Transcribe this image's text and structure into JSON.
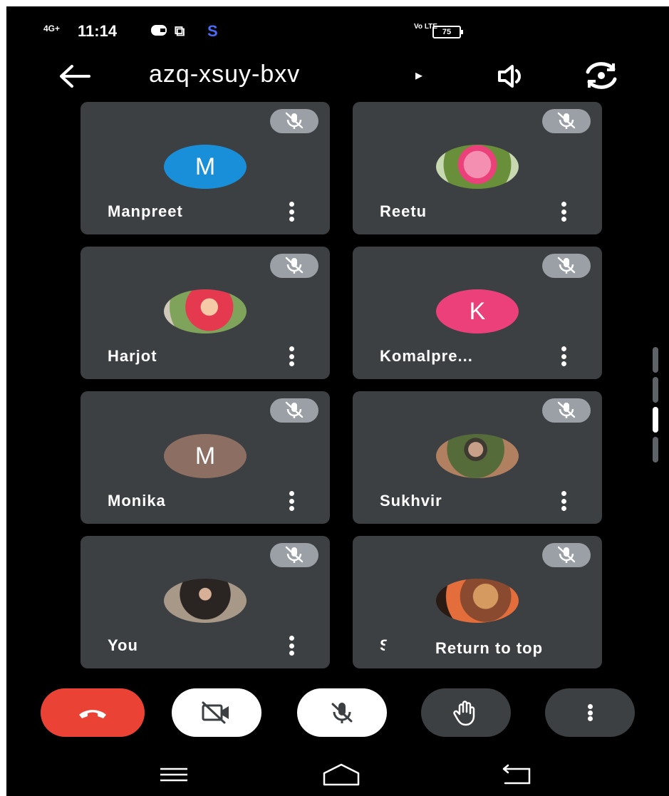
{
  "status_bar": {
    "signal": "4G+",
    "time": "11:14",
    "app_badge": "S",
    "volte": "Vo LTE",
    "battery": "75"
  },
  "header": {
    "meeting_code": "azq-xsuy-bxv",
    "caret": "▸"
  },
  "participants": [
    {
      "name": "Manpreet",
      "avatar_letter": "M",
      "avatar_color": "#1a8fd9",
      "avatar_kind": "letter"
    },
    {
      "name": "Reetu",
      "avatar_letter": "",
      "avatar_kind": "photo-rose"
    },
    {
      "name": "Harjot",
      "avatar_letter": "",
      "avatar_kind": "photo-child"
    },
    {
      "name": "Komalpre...",
      "avatar_letter": "K",
      "avatar_color": "#ec407a",
      "avatar_kind": "letter"
    },
    {
      "name": "Monika",
      "avatar_letter": "M",
      "avatar_color": "#8d6e63",
      "avatar_kind": "letter"
    },
    {
      "name": "Sukhvir",
      "avatar_letter": "",
      "avatar_kind": "photo-man"
    },
    {
      "name": "You",
      "avatar_letter": "",
      "avatar_kind": "photo-woman"
    },
    {
      "name": "Si",
      "avatar_letter": "",
      "avatar_kind": "photo-bear"
    }
  ],
  "return_to_top": "Return to top",
  "colors": {
    "tile_bg": "#3c4043",
    "end_call": "#ea4335",
    "mute_badge": "#9aa0a6"
  }
}
